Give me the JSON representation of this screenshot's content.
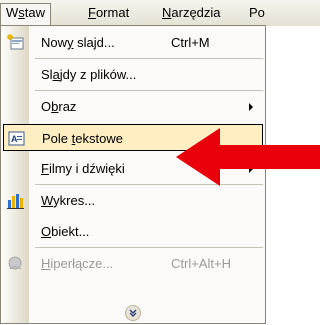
{
  "menubar": {
    "items": [
      {
        "pre": "W",
        "u": "s",
        "post": "taw"
      },
      {
        "pre": "",
        "u": "F",
        "post": "ormat"
      },
      {
        "pre": "",
        "u": "N",
        "post": "arzędzia"
      },
      {
        "pre": "",
        "u": "",
        "post": "Po"
      }
    ]
  },
  "menu": {
    "items": [
      {
        "pre": "Now",
        "u": "y",
        "post": " slajd...",
        "shortcut": "Ctrl+M"
      },
      {
        "pre": "Sl",
        "u": "a",
        "post": "jdy z plików..."
      },
      {
        "pre": "O",
        "u": "b",
        "post": "raz"
      },
      {
        "pre": "Pole ",
        "u": "t",
        "post": "ekstowe"
      },
      {
        "pre": "",
        "u": "F",
        "post": "ilmy i dźwięki"
      },
      {
        "pre": "",
        "u": "W",
        "post": "ykres..."
      },
      {
        "pre": "",
        "u": "O",
        "post": "biekt..."
      },
      {
        "pre": "",
        "u": "H",
        "post": "iperłącze...",
        "shortcut": "Ctrl+Alt+H"
      }
    ]
  },
  "colors": {
    "highlight_bg": "#ffeec2",
    "arrow": "#e8000b"
  },
  "icons": [
    "new-slide-icon",
    "text-box-icon",
    "chart-icon",
    "hyperlink-icon",
    "expand-chevrons-icon",
    "red-pointer-arrow"
  ]
}
